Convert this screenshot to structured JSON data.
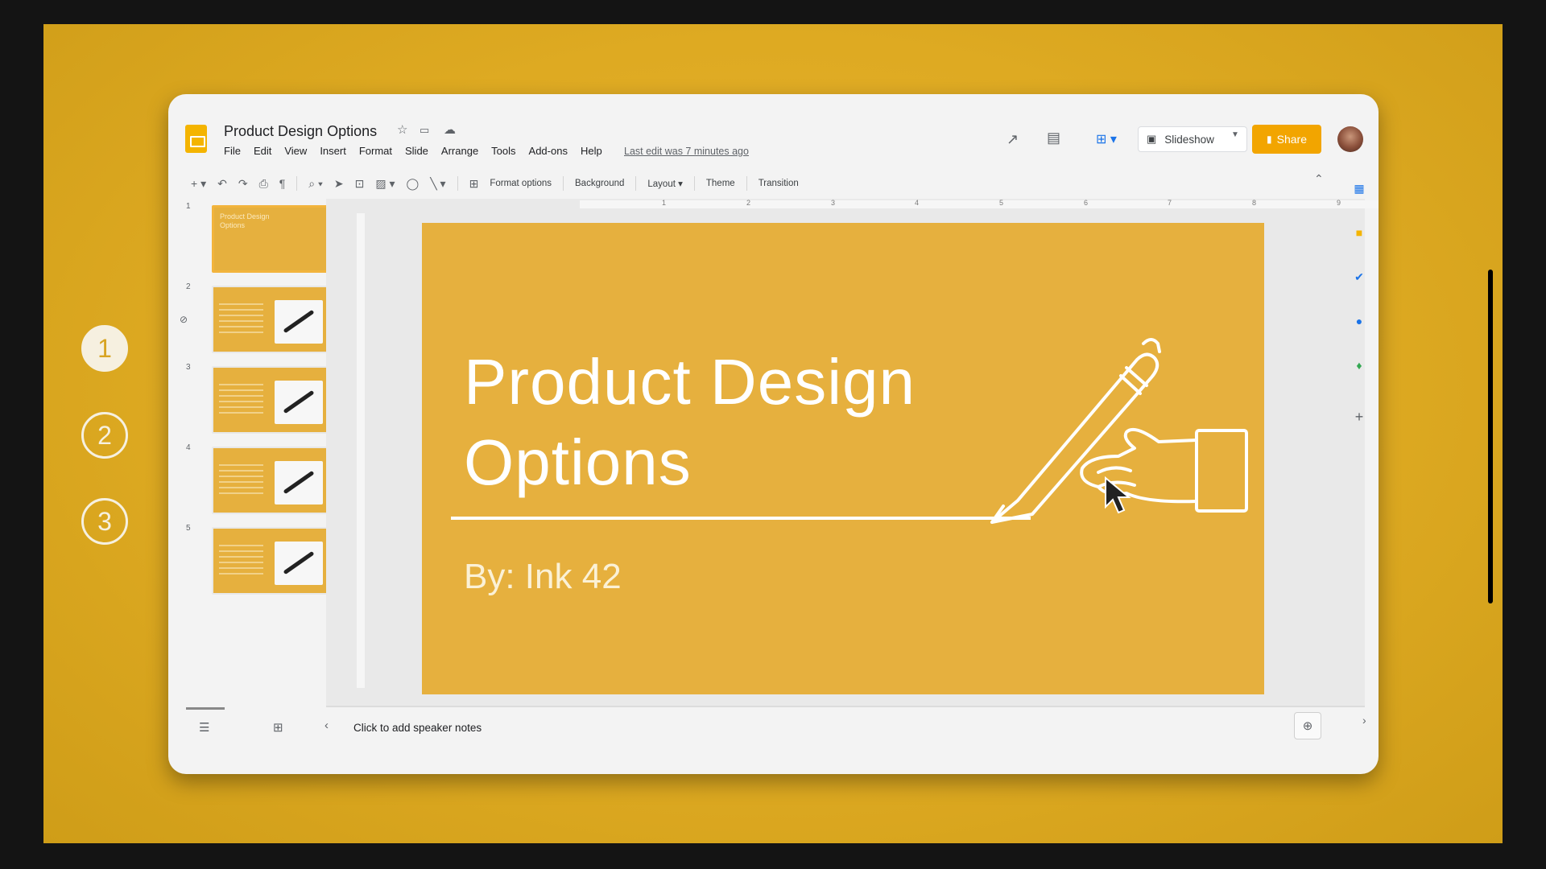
{
  "app": {
    "doc_title": "Product Design Options",
    "last_edit": "Last edit was 7 minutes ago",
    "menu": [
      "File",
      "Edit",
      "View",
      "Insert",
      "Format",
      "Slide",
      "Arrange",
      "Tools",
      "Add-ons",
      "Help"
    ],
    "slideshow_label": "Slideshow",
    "share_label": "Share"
  },
  "steps": [
    "1",
    "2",
    "3"
  ],
  "toolbar": {
    "format_options": "Format options",
    "background": "Background",
    "layout": "Layout",
    "theme": "Theme",
    "transition": "Transition"
  },
  "ruler": [
    "1",
    "2",
    "3",
    "4",
    "5",
    "6",
    "7",
    "8",
    "9"
  ],
  "filmstrip": {
    "slide_numbers": [
      "1",
      "2",
      "3",
      "4",
      "5"
    ],
    "selected_index": 0
  },
  "slide": {
    "title_line1": "Product Design",
    "title_line2": "Options",
    "byline": "By: Ink 42"
  },
  "notes": {
    "placeholder": "Click to add speaker notes"
  },
  "colors": {
    "background_yellow": "#deaa22",
    "slide_gold": "#e6b03e",
    "share_button": "#f2a500"
  },
  "icons": [
    "star-icon",
    "folder-icon",
    "cloud-icon",
    "trending-icon",
    "comment-icon",
    "present-icon",
    "slideshow-icon",
    "lock-icon",
    "calendar-icon",
    "keep-icon",
    "tasks-icon",
    "contacts-icon",
    "maps-icon",
    "plus-icon",
    "cursor-icon",
    "pen-hand-illustration"
  ]
}
